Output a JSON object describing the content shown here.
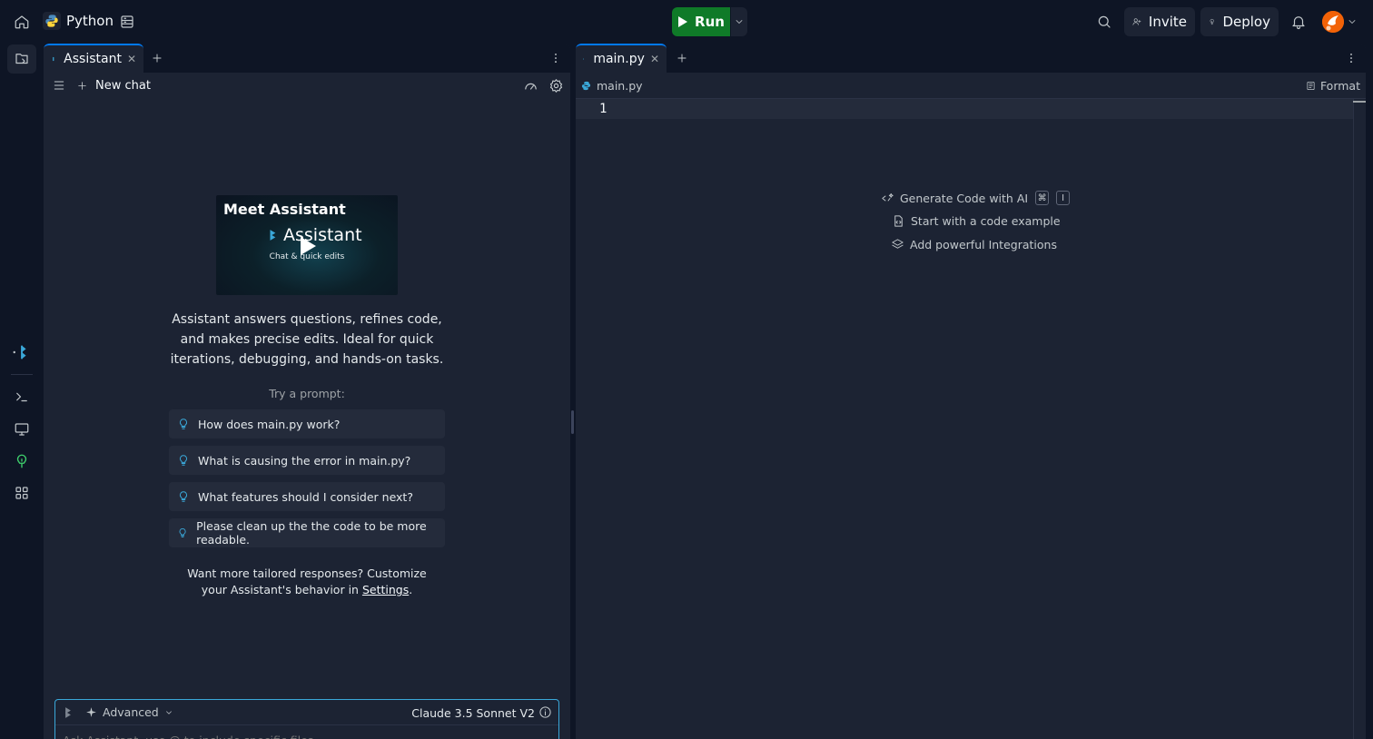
{
  "topbar": {
    "app_title": "Python",
    "run_label": "Run",
    "invite_label": "Invite",
    "deploy_label": "Deploy"
  },
  "assistant": {
    "tab_label": "Assistant",
    "new_chat_label": "New chat",
    "video": {
      "title": "Meet Assistant",
      "brand": "Assistant",
      "subtitle": "Chat & quick edits"
    },
    "intro": "Assistant answers questions, refines code, and makes precise edits. Ideal for quick iterations, debugging, and hands-on tasks.",
    "try_label": "Try a prompt:",
    "prompts": [
      "How does main.py work?",
      "What is causing the error in main.py?",
      "What features should I consider next?",
      "Please clean up the the code to be more readable."
    ],
    "footer_prefix": "Want more tailored responses? Customize your Assistant's behavior in ",
    "footer_link": "Settings",
    "footer_suffix": ".",
    "input": {
      "advanced_label": "Advanced",
      "model_label": "Claude 3.5 Sonnet V2",
      "placeholder": "Ask Assistant, use @ to include specific files..."
    }
  },
  "editor": {
    "tab_label": "main.py",
    "breadcrumb": "main.py",
    "format_label": "Format",
    "line_number": "1",
    "hints": {
      "generate": "Generate Code with AI",
      "kbd_cmd": "⌘",
      "kbd_key": "I",
      "example": "Start with a code example",
      "integrations": "Add powerful Integrations"
    }
  },
  "colors": {
    "background": "#0e1525",
    "panel": "#1c2333",
    "run_green": "#0f7a28",
    "accent_blue": "#0079f2",
    "input_border": "#3aa8d9"
  }
}
